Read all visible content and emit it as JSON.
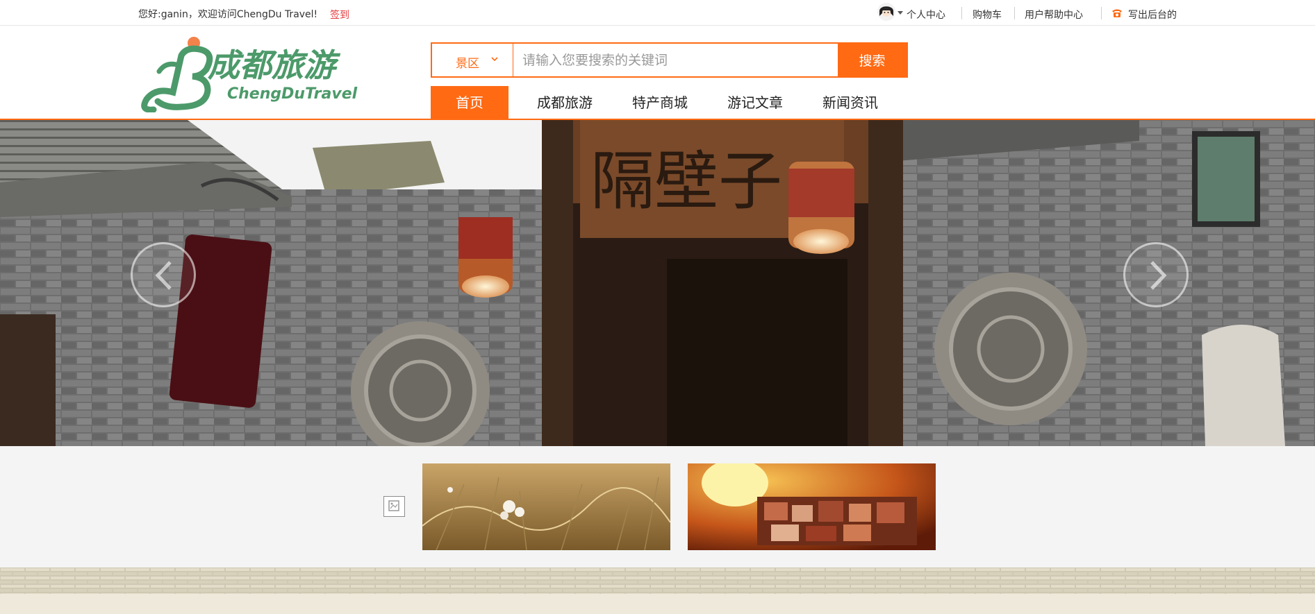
{
  "topbar": {
    "welcome_text": "您好:ganin，欢迎访问ChengDu Travel!",
    "signin_label": "签到",
    "personal_center": "个人中心",
    "cart": "购物车",
    "help_center": "用户帮助中心",
    "backend": "写出后台的"
  },
  "logo": {
    "title": "成都旅游",
    "subtitle": "ChengDuTravel"
  },
  "search": {
    "category": "景区",
    "placeholder": "请输入您要搜索的关键词",
    "button_label": "搜索"
  },
  "nav": {
    "items": [
      {
        "label": "首页",
        "active": true
      },
      {
        "label": "成都旅游",
        "active": false
      },
      {
        "label": "特产商城",
        "active": false
      },
      {
        "label": "游记文章",
        "active": false
      },
      {
        "label": "新闻资讯",
        "active": false
      }
    ]
  },
  "banner": {
    "sign_text": "隔壁子"
  },
  "colors": {
    "accent": "#ff6a13",
    "signin": "#e4393c",
    "logo_green": "#4c9a6a"
  },
  "icons": {
    "avatar": "avatar-icon",
    "phone": "phone-icon",
    "prev": "chevron-left-icon",
    "next": "chevron-right-icon",
    "broken_image": "broken-image-icon",
    "dropdown": "chevron-down-icon"
  }
}
